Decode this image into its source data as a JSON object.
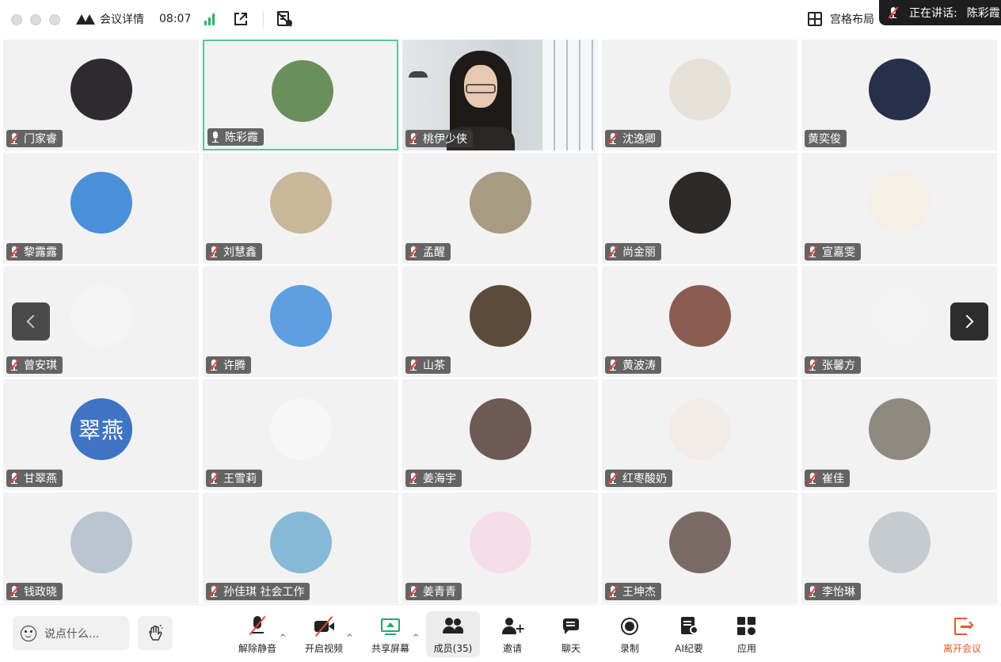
{
  "titlebar": {
    "meeting_details": "会议详情",
    "time": "08:07",
    "layout_label": "宫格布局"
  },
  "speaking_banner": {
    "label": "正在讲话:",
    "speaker": "陈彩霞"
  },
  "participants": [
    {
      "name": "门家睿",
      "muted": true
    },
    {
      "name": "陈彩霞",
      "muted": false,
      "active": true
    },
    {
      "name": "桃伊少侠",
      "muted": true,
      "video": true
    },
    {
      "name": "沈逸卿",
      "muted": true
    },
    {
      "name": "黄奕俊",
      "muted": false,
      "no_mic": true
    },
    {
      "name": "黎露露",
      "muted": true
    },
    {
      "name": "刘慧鑫",
      "muted": true
    },
    {
      "name": "孟醒",
      "muted": true
    },
    {
      "name": "尚金丽",
      "muted": true
    },
    {
      "name": "宣嘉雯",
      "muted": true
    },
    {
      "name": "曾安琪",
      "muted": true
    },
    {
      "name": "许腾",
      "muted": true
    },
    {
      "name": "山茶",
      "muted": true
    },
    {
      "name": "黄波涛",
      "muted": true
    },
    {
      "name": "张馨方",
      "muted": true
    },
    {
      "name": "甘翠燕",
      "muted": true,
      "avatar_text": "翠燕"
    },
    {
      "name": "王雪莉",
      "muted": true
    },
    {
      "name": "姜海宇",
      "muted": true
    },
    {
      "name": "红枣酸奶",
      "muted": true
    },
    {
      "name": "崔佳",
      "muted": true
    },
    {
      "name": "钱政晓",
      "muted": true
    },
    {
      "name": "孙佳琪 社会工作",
      "muted": true
    },
    {
      "name": "姜青青",
      "muted": true
    },
    {
      "name": "王坤杰",
      "muted": true
    },
    {
      "name": "李怡琳",
      "muted": true
    }
  ],
  "avatar_colors": [
    "#2d2a30",
    "#6b8f5a",
    "#d9dde1",
    "#e6e0d8",
    "#27304a",
    "#4a8fd8",
    "#c9b79a",
    "#a89b84",
    "#2b2a28",
    "#f6efe6",
    "#f5f5f5",
    "#5d9fe0",
    "#5d4b3a",
    "#8a5c52",
    "#f3f3f3",
    "#3f73c3",
    "#f7f7f7",
    "#6d5a54",
    "#f1ece8",
    "#8f8a80",
    "#b9c6d2",
    "#87b9d6",
    "#f7dde8",
    "#7a6a66",
    "#c6cbd0"
  ],
  "toolbar": {
    "chat_placeholder": "说点什么...",
    "unmute": "解除静音",
    "start_video": "开启视频",
    "share_screen": "共享屏幕",
    "members": "成员(35)",
    "invite": "邀请",
    "chat": "聊天",
    "record": "录制",
    "ai_minutes": "AI纪要",
    "apps": "应用",
    "leave": "离开会议"
  }
}
